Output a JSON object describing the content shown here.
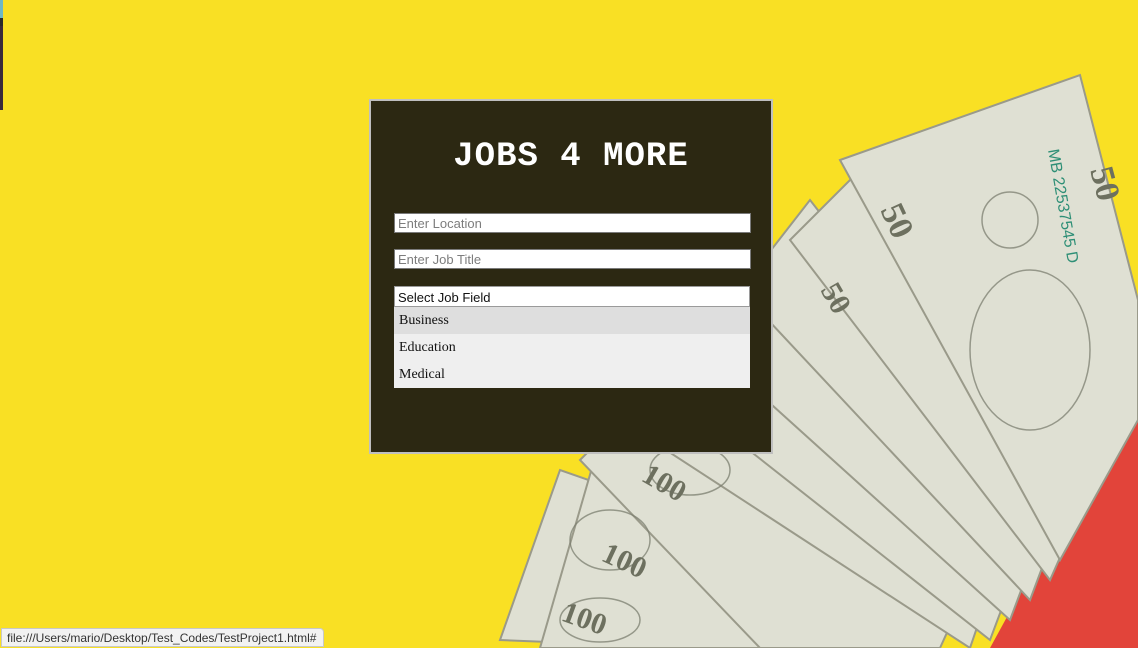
{
  "app": {
    "title": "JOBS 4 MORE"
  },
  "form": {
    "location_placeholder": "Enter Location",
    "job_title_placeholder": "Enter Job Title",
    "job_field_label": "Select Job Field",
    "job_field_options": [
      "Business",
      "Education",
      "Medical"
    ],
    "highlighted_option": "Business"
  },
  "status_bar": {
    "url": "file:///Users/mario/Desktop/Test_Codes/TestProject1.html#"
  },
  "colors": {
    "background": "#f9e024",
    "panel": "#2c2812",
    "title": "#ffffff"
  },
  "icons": {
    "background_image": "fan-of-dollar-bills-icon"
  }
}
